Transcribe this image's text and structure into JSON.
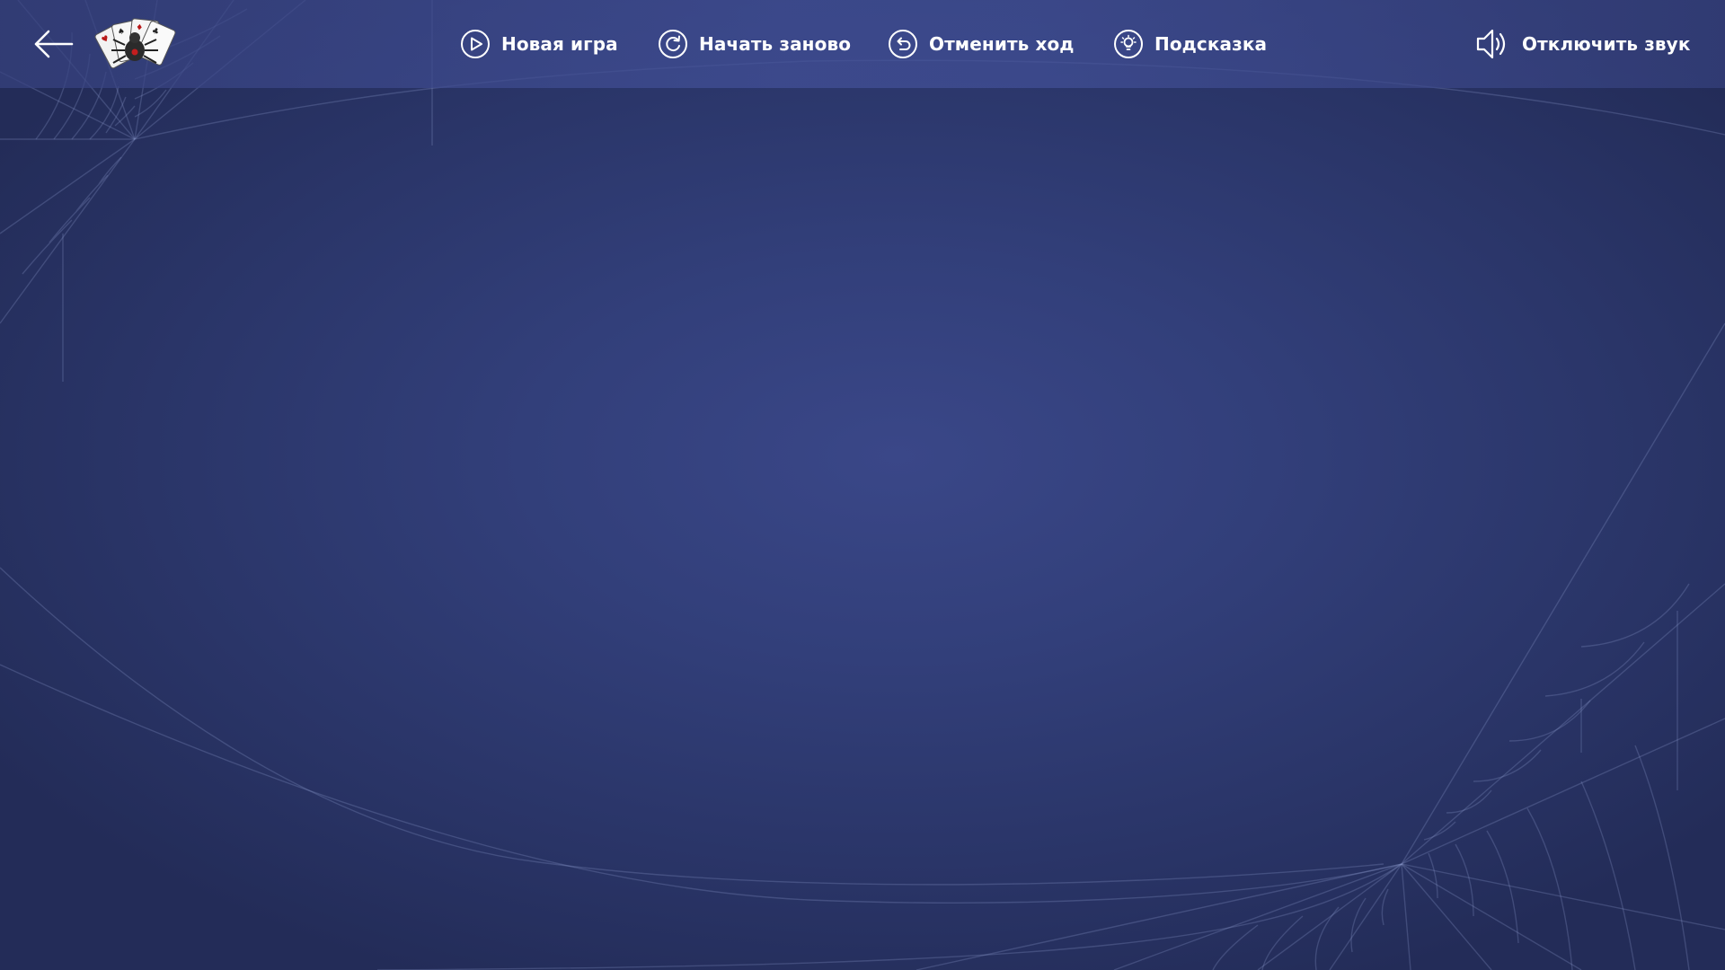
{
  "toolbar": {
    "new_game_label": "Новая игра",
    "restart_label": "Начать заново",
    "undo_label": "Отменить ход",
    "hint_label": "Подсказка",
    "mute_label": "Отключить звук"
  },
  "icons": {
    "back": "arrow-left-icon",
    "logo": "spider-solitaire-logo",
    "new_game": "play-circle-icon",
    "restart": "refresh-circle-icon",
    "undo": "undo-circle-icon",
    "hint": "lightbulb-circle-icon",
    "mute": "speaker-icon"
  },
  "colors": {
    "background": "#323f7a",
    "toolbar": "#3f4b8e",
    "text": "#ffffff",
    "web": "#8d99cc"
  }
}
